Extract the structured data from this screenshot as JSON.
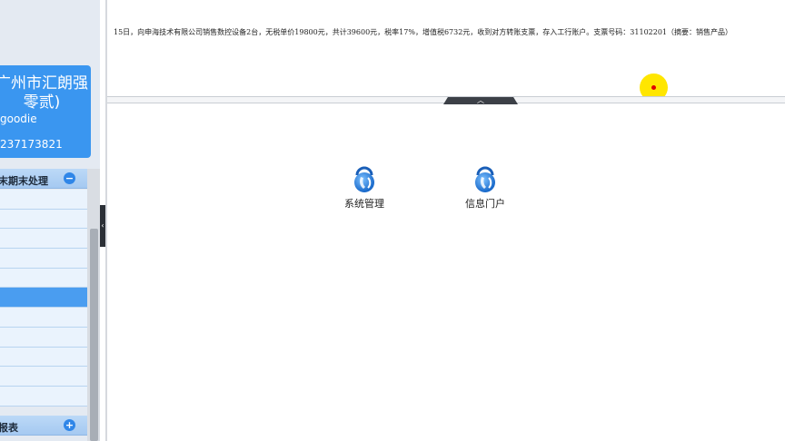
{
  "sidebar": {
    "company_name": "广州市汇朗强零贰)",
    "user": "goodie",
    "phone": "237173821",
    "menu_top_label": "末期末处理",
    "menu_bottom_label": "报表",
    "top_toggle_icon": "minus-icon",
    "bottom_toggle_icon": "plus-icon",
    "menu_items_count_visible": 11,
    "active_item_index": 5
  },
  "info": {
    "text": "15日，向申海技术有限公司销售数控设备2台，无税单价19800元，共计39600元，税率17%，增值税6732元，收到对方转账支票，存入工行账户。支票号码：31102201（摘要：销售产品）"
  },
  "desktop": {
    "icons": [
      {
        "label": "系统管理",
        "icon": "key-lock-icon"
      },
      {
        "label": "信息门户",
        "icon": "key-lock-icon"
      }
    ]
  },
  "colors": {
    "card": "#3a96f0",
    "menu_active": "#4a9df0",
    "cursor_highlight": "#ffe600",
    "cursor_dot": "#e00000"
  }
}
